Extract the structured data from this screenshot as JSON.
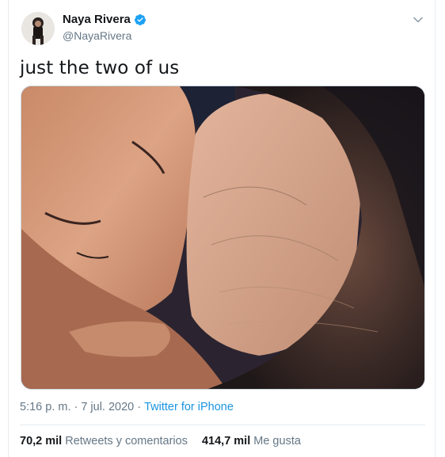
{
  "tweet": {
    "author_name": "Naya Rivera",
    "handle": "@NayaRivera",
    "verified": true,
    "text": "just the two of us",
    "media_alt": "photo",
    "time": "5:16 p. m.",
    "date": "7 jul. 2020",
    "separator": "·",
    "source": "Twitter for iPhone",
    "retweets_count": "70,2 mil",
    "retweets_label": "Retweets y comentarios",
    "likes_count": "414,7 mil",
    "likes_label": "Me gusta"
  },
  "colors": {
    "link": "#1b95e0",
    "muted": "#657786",
    "text": "#14171a",
    "verified": "#1da1f2"
  },
  "icons": {
    "verified": "verified-badge-icon",
    "menu": "chevron-down-icon"
  }
}
